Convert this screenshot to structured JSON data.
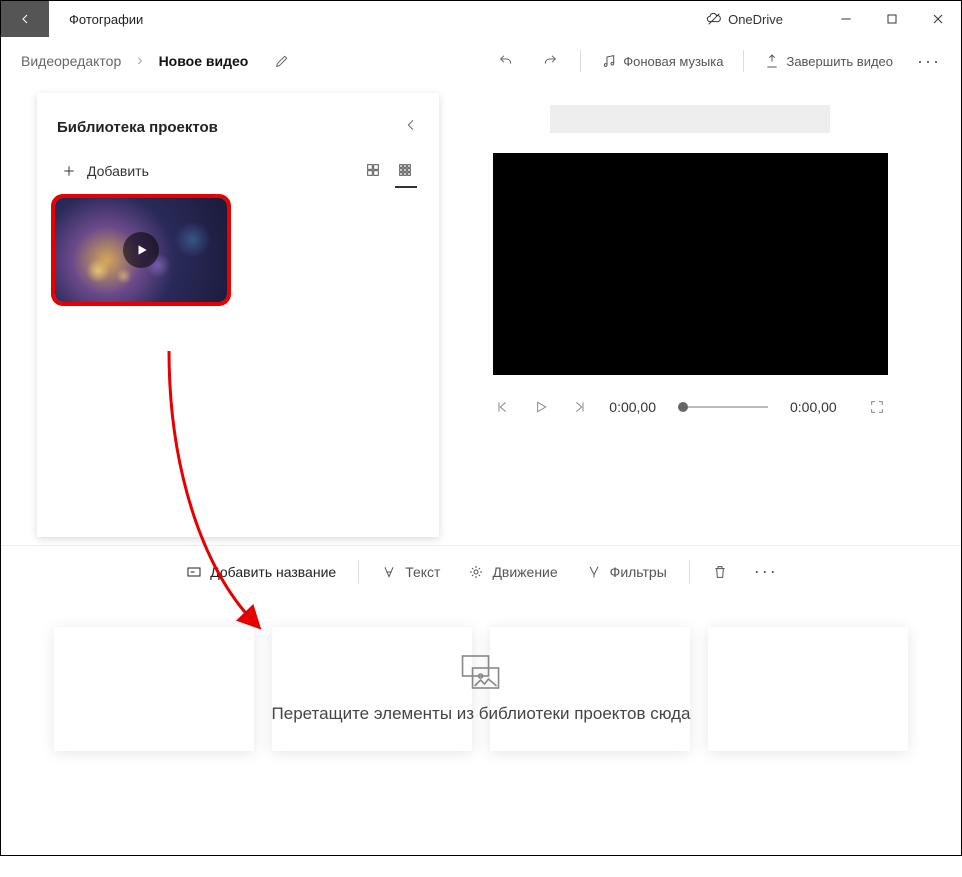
{
  "app": {
    "title": "Фотографии"
  },
  "titlebar": {
    "onedrive": "OneDrive"
  },
  "breadcrumb": {
    "editor": "Видеоредактор",
    "current": "Новое видео"
  },
  "toolbar": {
    "bg_music": "Фоновая музыка",
    "finish": "Завершить видео"
  },
  "library": {
    "title": "Библиотека проектов",
    "add": "Добавить"
  },
  "player": {
    "time_current": "0:00,00",
    "time_total": "0:00,00"
  },
  "storyboard": {
    "add_title": "Добавить название",
    "text": "Текст",
    "motion": "Движение",
    "filters": "Фильтры",
    "drop_hint": "Перетащите элементы из библиотеки проектов сюда"
  }
}
